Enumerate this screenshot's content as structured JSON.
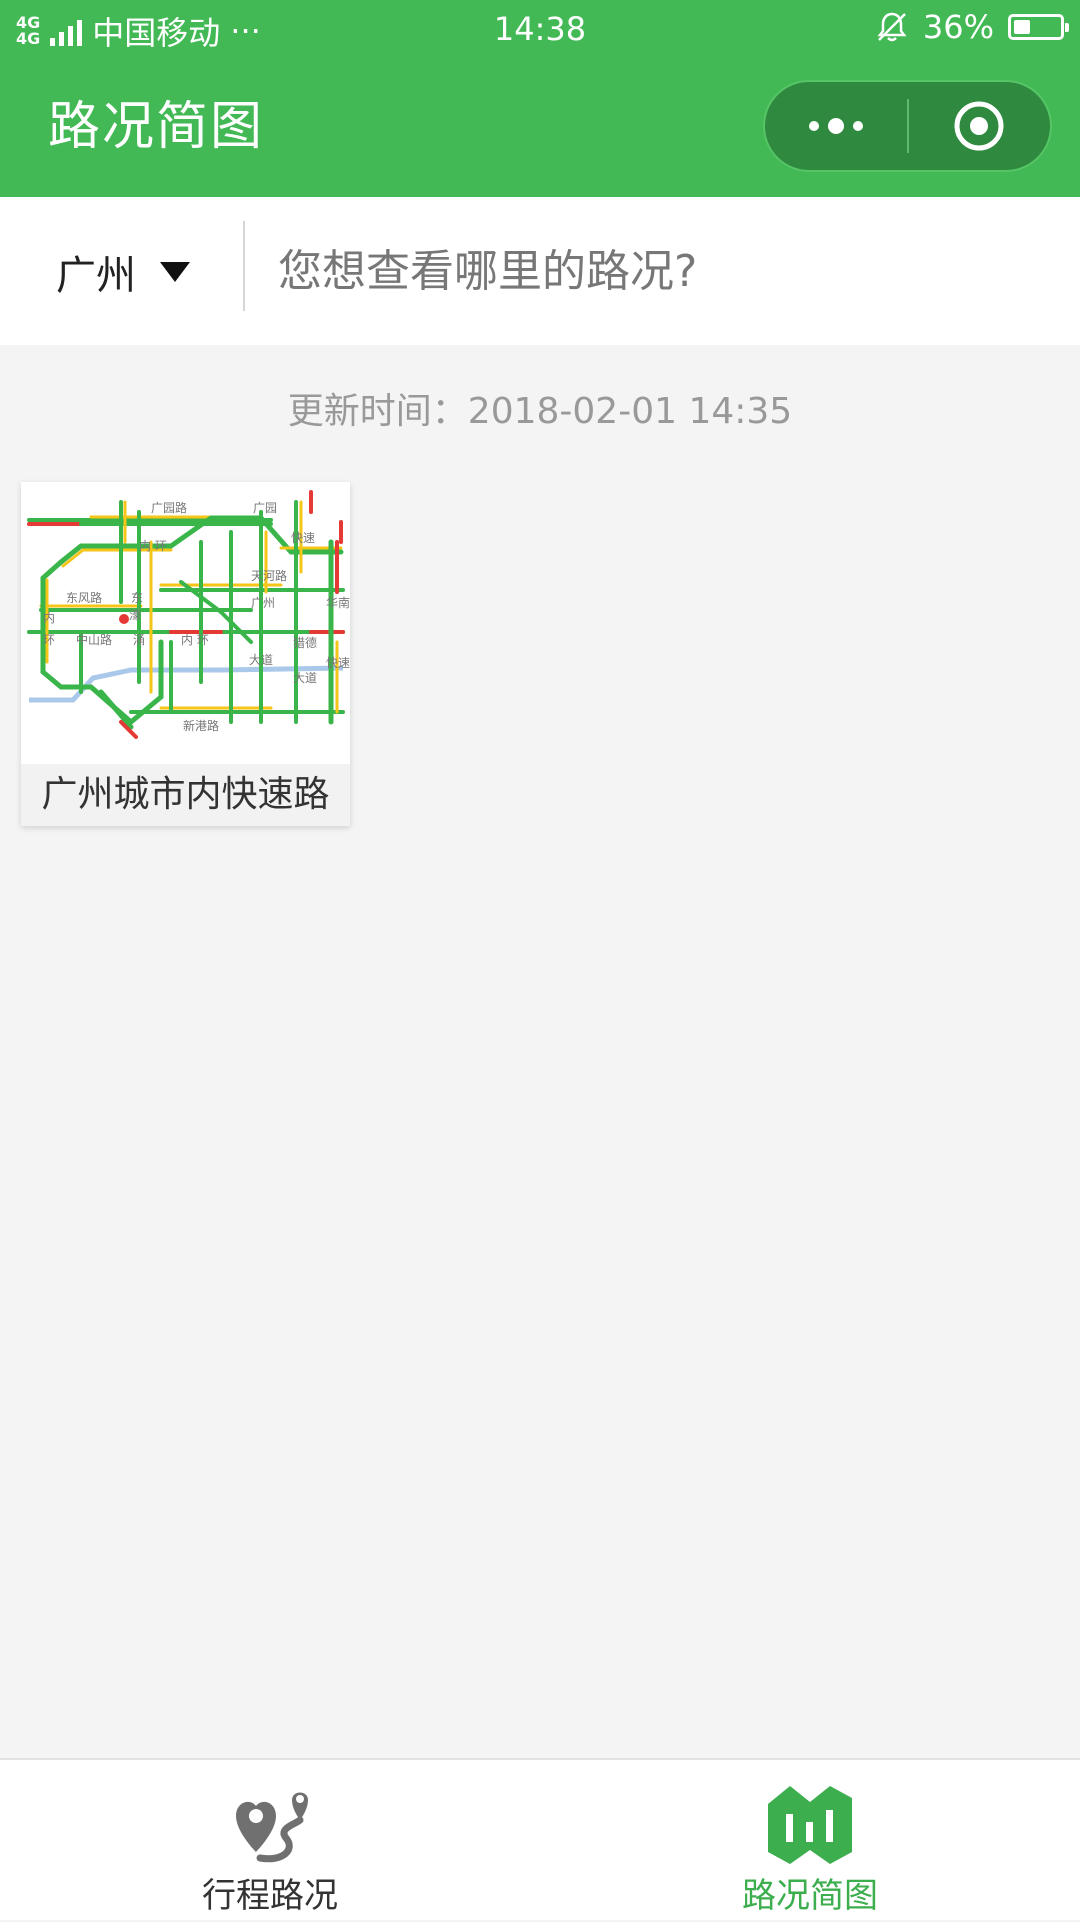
{
  "status_bar": {
    "network": "4G",
    "network2": "4G",
    "carrier": "中国移动",
    "more": "···",
    "time": "14:38",
    "battery": "36%",
    "battery_level": 0.36
  },
  "nav": {
    "title": "路况简图",
    "menu_icon": "more-dots-icon",
    "close_icon": "target-circle-icon"
  },
  "search": {
    "city": "广州",
    "placeholder": "您想查看哪里的路况?"
  },
  "update": {
    "text": "更新时间：2018-02-01 14:35"
  },
  "maps": [
    {
      "caption": "广州城市内快速路",
      "labels": [
        "广园路",
        "广园",
        "快速",
        "内 环",
        "天河路",
        "东风路",
        "东",
        "广州",
        "华南",
        "内",
        "环",
        "中山路",
        "涌",
        "内 环",
        "猎德",
        "大道",
        "大道",
        "快速",
        "新港路",
        "濠"
      ]
    }
  ],
  "tabs": [
    {
      "label": "行程路况",
      "icon": "route-pin-icon",
      "active": false
    },
    {
      "label": "路况简图",
      "icon": "folded-map-icon",
      "active": true
    }
  ],
  "colors": {
    "primary": "#42b955",
    "active_tab": "#3cae4e",
    "traffic_smooth": "#39b54a",
    "traffic_slow": "#f5c518",
    "traffic_jam": "#e53935",
    "river": "#a9c8ea"
  }
}
